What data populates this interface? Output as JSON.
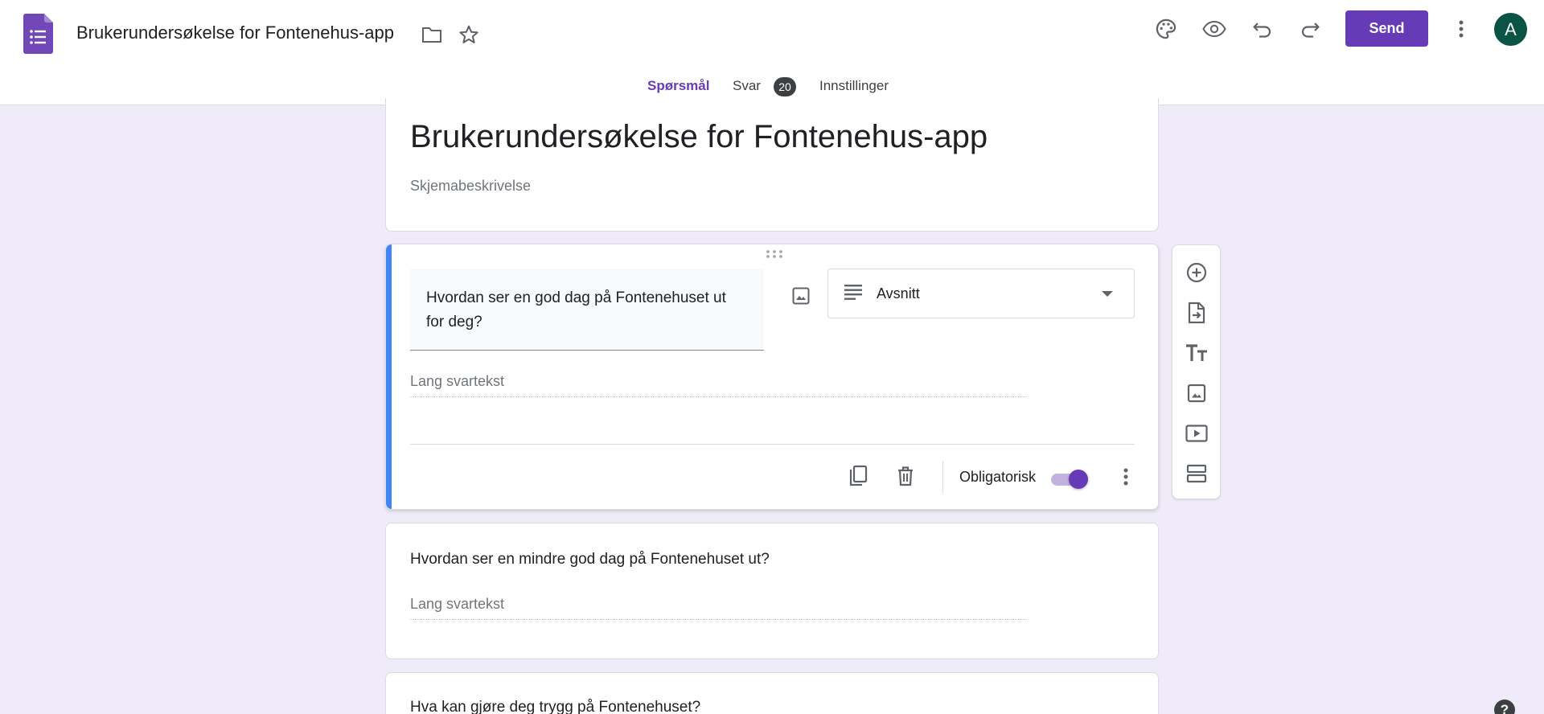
{
  "header": {
    "doc_title": "Brukerundersøkelse for Fontenehus-app",
    "send_label": "Send",
    "avatar_letter": "A"
  },
  "tabs": [
    {
      "label": "Spørsmål",
      "active": true
    },
    {
      "label": "Svar",
      "badge": "20"
    },
    {
      "label": "Innstillinger"
    }
  ],
  "form": {
    "title": "Brukerundersøkelse for Fontenehus-app",
    "description_placeholder": "Skjemabeskrivelse"
  },
  "questions": [
    {
      "text": "Hvordan ser en god dag på Fontenehuset ut for deg?",
      "type": "Avsnitt",
      "answer_placeholder": "Lang svartekst",
      "required_label": "Obligatorisk",
      "required": true
    },
    {
      "text": "Hvordan ser en mindre god dag på Fontenehuset ut?",
      "answer_placeholder": "Lang svartekst"
    },
    {
      "text": "Hva kan gjøre deg trygg på Fontenehuset?"
    }
  ],
  "colors": {
    "accent": "#673ab7",
    "background": "#f0ebf8",
    "active_question_bar": "#4285f4"
  },
  "icons": {
    "header": [
      "forms-logo-icon",
      "folder-icon",
      "star-icon",
      "palette-icon",
      "preview-eye-icon",
      "undo-icon",
      "redo-icon",
      "more-vert-icon"
    ],
    "side_toolbar": [
      "add-question-icon",
      "import-questions-icon",
      "add-title-icon",
      "add-image-icon",
      "add-video-icon",
      "add-section-icon"
    ]
  },
  "help_glyph": "?"
}
